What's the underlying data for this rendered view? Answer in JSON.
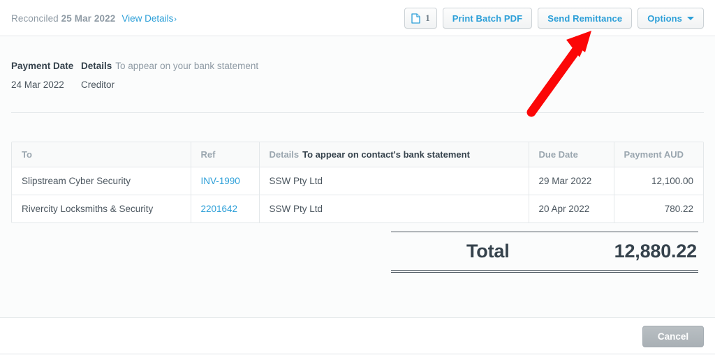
{
  "header": {
    "status_prefix": "Reconciled",
    "status_date": "25 Mar 2022",
    "view_details_label": "View Details",
    "view_details_chevron": "›",
    "attachment_icon": "file-icon",
    "attachment_count": "1",
    "print_batch_pdf_label": "Print Batch PDF",
    "send_remittance_label": "Send Remittance",
    "options_label": "Options",
    "options_caret": "caret-down-icon",
    "link_color": "#2c9fd8"
  },
  "summary": {
    "payment_date_label": "Payment Date",
    "details_label": "Details",
    "details_hint": "To appear on your bank statement",
    "payment_date_value": "24 Mar 2022",
    "details_value": "Creditor"
  },
  "table": {
    "columns": [
      {
        "key": "to",
        "label": "To"
      },
      {
        "key": "ref",
        "label": "Ref"
      },
      {
        "key": "details",
        "label": "Details",
        "sub_label": "To appear on contact's bank statement"
      },
      {
        "key": "due",
        "label": "Due Date"
      },
      {
        "key": "amount",
        "label": "Payment AUD"
      }
    ],
    "rows": [
      {
        "to": "Slipstream Cyber Security",
        "ref": "INV-1990",
        "details": "SSW Pty Ltd",
        "due": "29 Mar 2022",
        "amount": "12,100.00"
      },
      {
        "to": "Rivercity Locksmiths & Security",
        "ref": "2201642",
        "details": "SSW Pty Ltd",
        "due": "20 Apr 2022",
        "amount": "780.22"
      }
    ]
  },
  "total": {
    "label": "Total",
    "value": "12,880.22"
  },
  "footer": {
    "cancel_label": "Cancel"
  },
  "annotation": {
    "arrow_color": "#fb0707",
    "points_to": "send-remittance-button"
  }
}
